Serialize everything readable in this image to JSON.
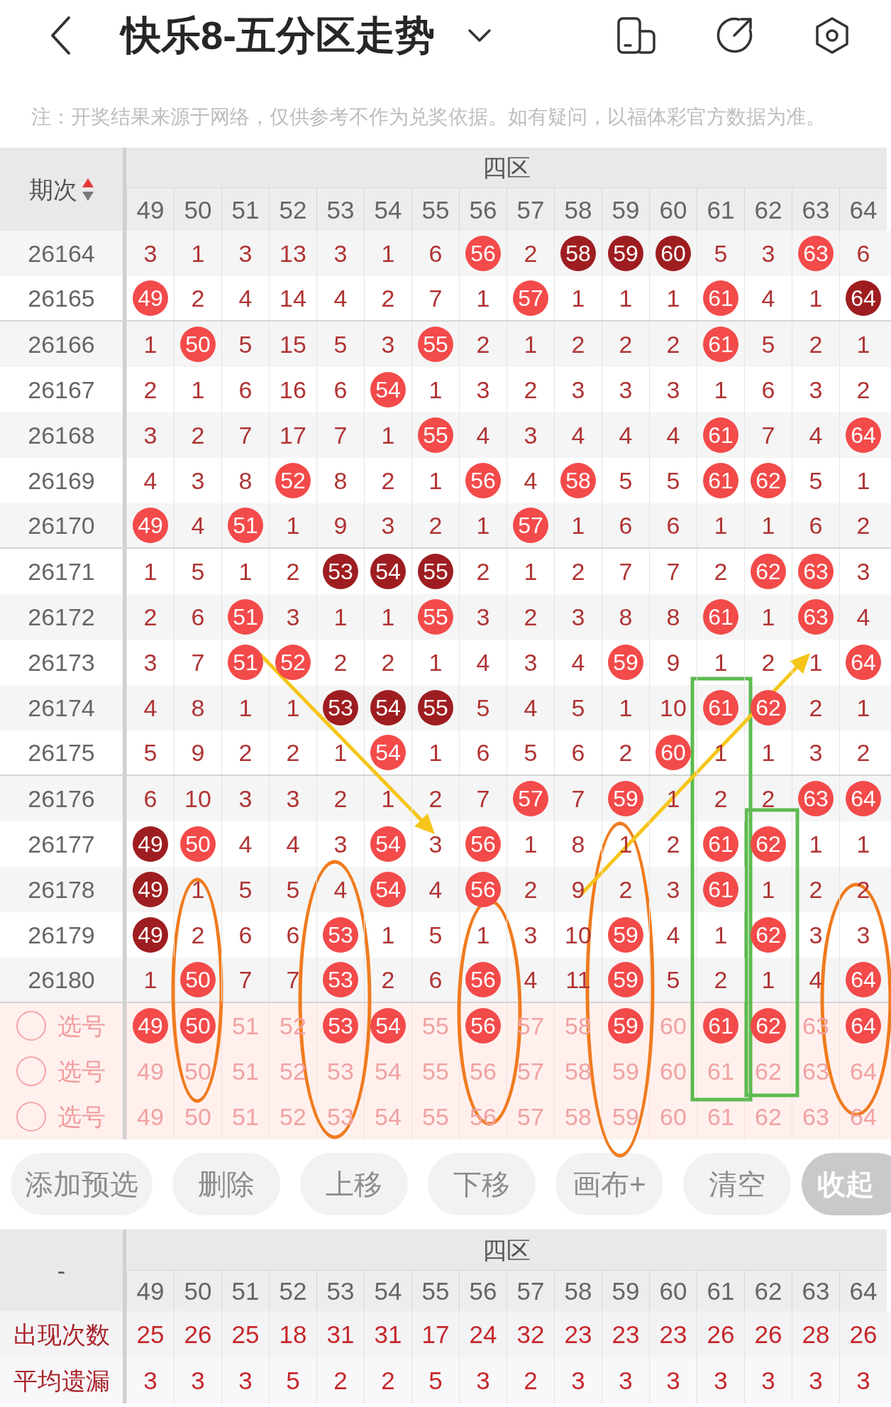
{
  "header": {
    "title": "快乐8-五分区走势"
  },
  "notice": "注：开奖结果来源于网络，仅供参考不作为兑奖依据。如有疑问，以福体彩官方数据为准。",
  "trend_table": {
    "period_header": "期次",
    "sort_ascending": true,
    "zone": "四区",
    "columns": [
      "49",
      "50",
      "51",
      "52",
      "53",
      "54",
      "55",
      "56",
      "57",
      "58",
      "59",
      "60",
      "61",
      "62",
      "63",
      "64"
    ],
    "rows": [
      {
        "period": "26164",
        "cells": [
          {
            "value": "3",
            "kind": "miss"
          },
          {
            "value": "1",
            "kind": "miss"
          },
          {
            "value": "3",
            "kind": "miss"
          },
          {
            "value": "13",
            "kind": "miss"
          },
          {
            "value": "3",
            "kind": "miss"
          },
          {
            "value": "1",
            "kind": "miss"
          },
          {
            "value": "6",
            "kind": "miss"
          },
          {
            "value": "56",
            "kind": "hit"
          },
          {
            "value": "2",
            "kind": "miss"
          },
          {
            "value": "58",
            "kind": "hit_dark"
          },
          {
            "value": "59",
            "kind": "hit_dark"
          },
          {
            "value": "60",
            "kind": "hit_dark"
          },
          {
            "value": "5",
            "kind": "miss"
          },
          {
            "value": "3",
            "kind": "miss"
          },
          {
            "value": "63",
            "kind": "hit"
          },
          {
            "value": "6",
            "kind": "miss"
          }
        ]
      },
      {
        "period": "26165",
        "cells": [
          {
            "value": "49",
            "kind": "hit"
          },
          {
            "value": "2",
            "kind": "miss"
          },
          {
            "value": "4",
            "kind": "miss"
          },
          {
            "value": "14",
            "kind": "miss"
          },
          {
            "value": "4",
            "kind": "miss"
          },
          {
            "value": "2",
            "kind": "miss"
          },
          {
            "value": "7",
            "kind": "miss"
          },
          {
            "value": "1",
            "kind": "miss"
          },
          {
            "value": "57",
            "kind": "hit"
          },
          {
            "value": "1",
            "kind": "miss"
          },
          {
            "value": "1",
            "kind": "miss"
          },
          {
            "value": "1",
            "kind": "miss"
          },
          {
            "value": "61",
            "kind": "hit"
          },
          {
            "value": "4",
            "kind": "miss"
          },
          {
            "value": "1",
            "kind": "miss"
          },
          {
            "value": "64",
            "kind": "hit_dark"
          }
        ]
      },
      {
        "period": "26166",
        "cells": [
          {
            "value": "1",
            "kind": "miss"
          },
          {
            "value": "50",
            "kind": "hit"
          },
          {
            "value": "5",
            "kind": "miss"
          },
          {
            "value": "15",
            "kind": "miss"
          },
          {
            "value": "5",
            "kind": "miss"
          },
          {
            "value": "3",
            "kind": "miss"
          },
          {
            "value": "55",
            "kind": "hit"
          },
          {
            "value": "2",
            "kind": "miss"
          },
          {
            "value": "1",
            "kind": "miss"
          },
          {
            "value": "2",
            "kind": "miss"
          },
          {
            "value": "2",
            "kind": "miss"
          },
          {
            "value": "2",
            "kind": "miss"
          },
          {
            "value": "61",
            "kind": "hit"
          },
          {
            "value": "5",
            "kind": "miss"
          },
          {
            "value": "2",
            "kind": "miss"
          },
          {
            "value": "1",
            "kind": "miss"
          }
        ]
      },
      {
        "period": "26167",
        "cells": [
          {
            "value": "2",
            "kind": "miss"
          },
          {
            "value": "1",
            "kind": "miss"
          },
          {
            "value": "6",
            "kind": "miss"
          },
          {
            "value": "16",
            "kind": "miss"
          },
          {
            "value": "6",
            "kind": "miss"
          },
          {
            "value": "54",
            "kind": "hit"
          },
          {
            "value": "1",
            "kind": "miss"
          },
          {
            "value": "3",
            "kind": "miss"
          },
          {
            "value": "2",
            "kind": "miss"
          },
          {
            "value": "3",
            "kind": "miss"
          },
          {
            "value": "3",
            "kind": "miss"
          },
          {
            "value": "3",
            "kind": "miss"
          },
          {
            "value": "1",
            "kind": "miss"
          },
          {
            "value": "6",
            "kind": "miss"
          },
          {
            "value": "3",
            "kind": "miss"
          },
          {
            "value": "2",
            "kind": "miss"
          }
        ]
      },
      {
        "period": "26168",
        "cells": [
          {
            "value": "3",
            "kind": "miss"
          },
          {
            "value": "2",
            "kind": "miss"
          },
          {
            "value": "7",
            "kind": "miss"
          },
          {
            "value": "17",
            "kind": "miss"
          },
          {
            "value": "7",
            "kind": "miss"
          },
          {
            "value": "1",
            "kind": "miss"
          },
          {
            "value": "55",
            "kind": "hit"
          },
          {
            "value": "4",
            "kind": "miss"
          },
          {
            "value": "3",
            "kind": "miss"
          },
          {
            "value": "4",
            "kind": "miss"
          },
          {
            "value": "4",
            "kind": "miss"
          },
          {
            "value": "4",
            "kind": "miss"
          },
          {
            "value": "61",
            "kind": "hit"
          },
          {
            "value": "7",
            "kind": "miss"
          },
          {
            "value": "4",
            "kind": "miss"
          },
          {
            "value": "64",
            "kind": "hit"
          }
        ]
      },
      {
        "period": "26169",
        "cells": [
          {
            "value": "4",
            "kind": "miss"
          },
          {
            "value": "3",
            "kind": "miss"
          },
          {
            "value": "8",
            "kind": "miss"
          },
          {
            "value": "52",
            "kind": "hit"
          },
          {
            "value": "8",
            "kind": "miss"
          },
          {
            "value": "2",
            "kind": "miss"
          },
          {
            "value": "1",
            "kind": "miss"
          },
          {
            "value": "56",
            "kind": "hit"
          },
          {
            "value": "4",
            "kind": "miss"
          },
          {
            "value": "58",
            "kind": "hit"
          },
          {
            "value": "5",
            "kind": "miss"
          },
          {
            "value": "5",
            "kind": "miss"
          },
          {
            "value": "61",
            "kind": "hit"
          },
          {
            "value": "62",
            "kind": "hit"
          },
          {
            "value": "5",
            "kind": "miss"
          },
          {
            "value": "1",
            "kind": "miss"
          }
        ]
      },
      {
        "period": "26170",
        "cells": [
          {
            "value": "49",
            "kind": "hit"
          },
          {
            "value": "4",
            "kind": "miss"
          },
          {
            "value": "51",
            "kind": "hit"
          },
          {
            "value": "1",
            "kind": "miss"
          },
          {
            "value": "9",
            "kind": "miss"
          },
          {
            "value": "3",
            "kind": "miss"
          },
          {
            "value": "2",
            "kind": "miss"
          },
          {
            "value": "1",
            "kind": "miss"
          },
          {
            "value": "57",
            "kind": "hit"
          },
          {
            "value": "1",
            "kind": "miss"
          },
          {
            "value": "6",
            "kind": "miss"
          },
          {
            "value": "6",
            "kind": "miss"
          },
          {
            "value": "1",
            "kind": "miss"
          },
          {
            "value": "1",
            "kind": "miss"
          },
          {
            "value": "6",
            "kind": "miss"
          },
          {
            "value": "2",
            "kind": "miss"
          }
        ]
      },
      {
        "period": "26171",
        "cells": [
          {
            "value": "1",
            "kind": "miss"
          },
          {
            "value": "5",
            "kind": "miss"
          },
          {
            "value": "1",
            "kind": "miss"
          },
          {
            "value": "2",
            "kind": "miss"
          },
          {
            "value": "53",
            "kind": "hit_dark"
          },
          {
            "value": "54",
            "kind": "hit_dark"
          },
          {
            "value": "55",
            "kind": "hit_dark"
          },
          {
            "value": "2",
            "kind": "miss"
          },
          {
            "value": "1",
            "kind": "miss"
          },
          {
            "value": "2",
            "kind": "miss"
          },
          {
            "value": "7",
            "kind": "miss"
          },
          {
            "value": "7",
            "kind": "miss"
          },
          {
            "value": "2",
            "kind": "miss"
          },
          {
            "value": "62",
            "kind": "hit"
          },
          {
            "value": "63",
            "kind": "hit"
          },
          {
            "value": "3",
            "kind": "miss"
          }
        ]
      },
      {
        "period": "26172",
        "cells": [
          {
            "value": "2",
            "kind": "miss"
          },
          {
            "value": "6",
            "kind": "miss"
          },
          {
            "value": "51",
            "kind": "hit"
          },
          {
            "value": "3",
            "kind": "miss"
          },
          {
            "value": "1",
            "kind": "miss"
          },
          {
            "value": "1",
            "kind": "miss"
          },
          {
            "value": "55",
            "kind": "hit"
          },
          {
            "value": "3",
            "kind": "miss"
          },
          {
            "value": "2",
            "kind": "miss"
          },
          {
            "value": "3",
            "kind": "miss"
          },
          {
            "value": "8",
            "kind": "miss"
          },
          {
            "value": "8",
            "kind": "miss"
          },
          {
            "value": "61",
            "kind": "hit"
          },
          {
            "value": "1",
            "kind": "miss"
          },
          {
            "value": "63",
            "kind": "hit"
          },
          {
            "value": "4",
            "kind": "miss"
          }
        ]
      },
      {
        "period": "26173",
        "cells": [
          {
            "value": "3",
            "kind": "miss"
          },
          {
            "value": "7",
            "kind": "miss"
          },
          {
            "value": "51",
            "kind": "hit"
          },
          {
            "value": "52",
            "kind": "hit"
          },
          {
            "value": "2",
            "kind": "miss"
          },
          {
            "value": "2",
            "kind": "miss"
          },
          {
            "value": "1",
            "kind": "miss"
          },
          {
            "value": "4",
            "kind": "miss"
          },
          {
            "value": "3",
            "kind": "miss"
          },
          {
            "value": "4",
            "kind": "miss"
          },
          {
            "value": "59",
            "kind": "hit"
          },
          {
            "value": "9",
            "kind": "miss"
          },
          {
            "value": "1",
            "kind": "miss"
          },
          {
            "value": "2",
            "kind": "miss"
          },
          {
            "value": "1",
            "kind": "miss"
          },
          {
            "value": "64",
            "kind": "hit"
          }
        ]
      },
      {
        "period": "26174",
        "cells": [
          {
            "value": "4",
            "kind": "miss"
          },
          {
            "value": "8",
            "kind": "miss"
          },
          {
            "value": "1",
            "kind": "miss"
          },
          {
            "value": "1",
            "kind": "miss"
          },
          {
            "value": "53",
            "kind": "hit_dark"
          },
          {
            "value": "54",
            "kind": "hit_dark"
          },
          {
            "value": "55",
            "kind": "hit_dark"
          },
          {
            "value": "5",
            "kind": "miss"
          },
          {
            "value": "4",
            "kind": "miss"
          },
          {
            "value": "5",
            "kind": "miss"
          },
          {
            "value": "1",
            "kind": "miss"
          },
          {
            "value": "10",
            "kind": "miss"
          },
          {
            "value": "61",
            "kind": "hit"
          },
          {
            "value": "62",
            "kind": "hit"
          },
          {
            "value": "2",
            "kind": "miss"
          },
          {
            "value": "1",
            "kind": "miss"
          }
        ]
      },
      {
        "period": "26175",
        "cells": [
          {
            "value": "5",
            "kind": "miss"
          },
          {
            "value": "9",
            "kind": "miss"
          },
          {
            "value": "2",
            "kind": "miss"
          },
          {
            "value": "2",
            "kind": "miss"
          },
          {
            "value": "1",
            "kind": "miss"
          },
          {
            "value": "54",
            "kind": "hit"
          },
          {
            "value": "1",
            "kind": "miss"
          },
          {
            "value": "6",
            "kind": "miss"
          },
          {
            "value": "5",
            "kind": "miss"
          },
          {
            "value": "6",
            "kind": "miss"
          },
          {
            "value": "2",
            "kind": "miss"
          },
          {
            "value": "60",
            "kind": "hit"
          },
          {
            "value": "1",
            "kind": "miss"
          },
          {
            "value": "1",
            "kind": "miss"
          },
          {
            "value": "3",
            "kind": "miss"
          },
          {
            "value": "2",
            "kind": "miss"
          }
        ]
      },
      {
        "period": "26176",
        "cells": [
          {
            "value": "6",
            "kind": "miss"
          },
          {
            "value": "10",
            "kind": "miss"
          },
          {
            "value": "3",
            "kind": "miss"
          },
          {
            "value": "3",
            "kind": "miss"
          },
          {
            "value": "2",
            "kind": "miss"
          },
          {
            "value": "1",
            "kind": "miss"
          },
          {
            "value": "2",
            "kind": "miss"
          },
          {
            "value": "7",
            "kind": "miss"
          },
          {
            "value": "57",
            "kind": "hit"
          },
          {
            "value": "7",
            "kind": "miss"
          },
          {
            "value": "59",
            "kind": "hit"
          },
          {
            "value": "1",
            "kind": "miss"
          },
          {
            "value": "2",
            "kind": "miss"
          },
          {
            "value": "2",
            "kind": "miss"
          },
          {
            "value": "63",
            "kind": "hit"
          },
          {
            "value": "64",
            "kind": "hit"
          }
        ]
      },
      {
        "period": "26177",
        "cells": [
          {
            "value": "49",
            "kind": "hit_dark"
          },
          {
            "value": "50",
            "kind": "hit"
          },
          {
            "value": "4",
            "kind": "miss"
          },
          {
            "value": "4",
            "kind": "miss"
          },
          {
            "value": "3",
            "kind": "miss"
          },
          {
            "value": "54",
            "kind": "hit"
          },
          {
            "value": "3",
            "kind": "miss"
          },
          {
            "value": "56",
            "kind": "hit"
          },
          {
            "value": "1",
            "kind": "miss"
          },
          {
            "value": "8",
            "kind": "miss"
          },
          {
            "value": "1",
            "kind": "miss"
          },
          {
            "value": "2",
            "kind": "miss"
          },
          {
            "value": "61",
            "kind": "hit"
          },
          {
            "value": "62",
            "kind": "hit"
          },
          {
            "value": "1",
            "kind": "miss"
          },
          {
            "value": "1",
            "kind": "miss"
          }
        ]
      },
      {
        "period": "26178",
        "cells": [
          {
            "value": "49",
            "kind": "hit_dark"
          },
          {
            "value": "1",
            "kind": "miss"
          },
          {
            "value": "5",
            "kind": "miss"
          },
          {
            "value": "5",
            "kind": "miss"
          },
          {
            "value": "4",
            "kind": "miss"
          },
          {
            "value": "54",
            "kind": "hit"
          },
          {
            "value": "4",
            "kind": "miss"
          },
          {
            "value": "56",
            "kind": "hit"
          },
          {
            "value": "2",
            "kind": "miss"
          },
          {
            "value": "9",
            "kind": "miss"
          },
          {
            "value": "2",
            "kind": "miss"
          },
          {
            "value": "3",
            "kind": "miss"
          },
          {
            "value": "61",
            "kind": "hit"
          },
          {
            "value": "1",
            "kind": "miss"
          },
          {
            "value": "2",
            "kind": "miss"
          },
          {
            "value": "2",
            "kind": "miss"
          }
        ]
      },
      {
        "period": "26179",
        "cells": [
          {
            "value": "49",
            "kind": "hit_dark"
          },
          {
            "value": "2",
            "kind": "miss"
          },
          {
            "value": "6",
            "kind": "miss"
          },
          {
            "value": "6",
            "kind": "miss"
          },
          {
            "value": "53",
            "kind": "hit"
          },
          {
            "value": "1",
            "kind": "miss"
          },
          {
            "value": "5",
            "kind": "miss"
          },
          {
            "value": "1",
            "kind": "miss"
          },
          {
            "value": "3",
            "kind": "miss"
          },
          {
            "value": "10",
            "kind": "miss"
          },
          {
            "value": "59",
            "kind": "hit"
          },
          {
            "value": "4",
            "kind": "miss"
          },
          {
            "value": "1",
            "kind": "miss"
          },
          {
            "value": "62",
            "kind": "hit"
          },
          {
            "value": "3",
            "kind": "miss"
          },
          {
            "value": "3",
            "kind": "miss"
          }
        ]
      },
      {
        "period": "26180",
        "cells": [
          {
            "value": "1",
            "kind": "miss"
          },
          {
            "value": "50",
            "kind": "hit"
          },
          {
            "value": "7",
            "kind": "miss"
          },
          {
            "value": "7",
            "kind": "miss"
          },
          {
            "value": "53",
            "kind": "hit"
          },
          {
            "value": "2",
            "kind": "miss"
          },
          {
            "value": "6",
            "kind": "miss"
          },
          {
            "value": "56",
            "kind": "hit"
          },
          {
            "value": "4",
            "kind": "miss"
          },
          {
            "value": "11",
            "kind": "miss"
          },
          {
            "value": "59",
            "kind": "hit"
          },
          {
            "value": "5",
            "kind": "miss"
          },
          {
            "value": "2",
            "kind": "miss"
          },
          {
            "value": "1",
            "kind": "miss"
          },
          {
            "value": "4",
            "kind": "miss"
          },
          {
            "value": "64",
            "kind": "hit"
          }
        ]
      }
    ],
    "pick_rows": [
      {
        "label": "选号",
        "checked": false,
        "cells": [
          {
            "value": "49",
            "selected": true
          },
          {
            "value": "50",
            "selected": true
          },
          {
            "value": "51",
            "selected": false
          },
          {
            "value": "52",
            "selected": false
          },
          {
            "value": "53",
            "selected": true
          },
          {
            "value": "54",
            "selected": true
          },
          {
            "value": "55",
            "selected": false
          },
          {
            "value": "56",
            "selected": true
          },
          {
            "value": "57",
            "selected": false
          },
          {
            "value": "58",
            "selected": false
          },
          {
            "value": "59",
            "selected": true
          },
          {
            "value": "60",
            "selected": false
          },
          {
            "value": "61",
            "selected": true
          },
          {
            "value": "62",
            "selected": true
          },
          {
            "value": "63",
            "selected": false
          },
          {
            "value": "64",
            "selected": true
          }
        ]
      },
      {
        "label": "选号",
        "checked": false,
        "cells": [
          {
            "value": "49",
            "selected": false
          },
          {
            "value": "50",
            "selected": false
          },
          {
            "value": "51",
            "selected": false
          },
          {
            "value": "52",
            "selected": false
          },
          {
            "value": "53",
            "selected": false
          },
          {
            "value": "54",
            "selected": false
          },
          {
            "value": "55",
            "selected": false
          },
          {
            "value": "56",
            "selected": false
          },
          {
            "value": "57",
            "selected": false
          },
          {
            "value": "58",
            "selected": false
          },
          {
            "value": "59",
            "selected": false
          },
          {
            "value": "60",
            "selected": false
          },
          {
            "value": "61",
            "selected": false
          },
          {
            "value": "62",
            "selected": false
          },
          {
            "value": "63",
            "selected": false
          },
          {
            "value": "64",
            "selected": false
          }
        ]
      },
      {
        "label": "选号",
        "checked": false,
        "cells": [
          {
            "value": "49",
            "selected": false
          },
          {
            "value": "50",
            "selected": false
          },
          {
            "value": "51",
            "selected": false
          },
          {
            "value": "52",
            "selected": false
          },
          {
            "value": "53",
            "selected": false
          },
          {
            "value": "54",
            "selected": false
          },
          {
            "value": "55",
            "selected": false
          },
          {
            "value": "56",
            "selected": false
          },
          {
            "value": "57",
            "selected": false
          },
          {
            "value": "58",
            "selected": false
          },
          {
            "value": "59",
            "selected": false
          },
          {
            "value": "60",
            "selected": false
          },
          {
            "value": "61",
            "selected": false
          },
          {
            "value": "62",
            "selected": false
          },
          {
            "value": "63",
            "selected": false
          },
          {
            "value": "64",
            "selected": false
          }
        ]
      }
    ]
  },
  "buttons": [
    {
      "label": "添加预选",
      "kind": "action"
    },
    {
      "label": "删除",
      "kind": "action"
    },
    {
      "label": "上移",
      "kind": "action"
    },
    {
      "label": "下移",
      "kind": "action"
    },
    {
      "label": "画布+",
      "kind": "action"
    },
    {
      "label": "清空",
      "kind": "action"
    },
    {
      "label": "收起",
      "kind": "collapse"
    }
  ],
  "stats_table": {
    "corner": "-",
    "zone": "四区",
    "columns": [
      "49",
      "50",
      "51",
      "52",
      "53",
      "54",
      "55",
      "56",
      "57",
      "58",
      "59",
      "60",
      "61",
      "62",
      "63",
      "64"
    ],
    "rows": [
      {
        "label": "出现次数",
        "values": [
          "25",
          "26",
          "25",
          "18",
          "31",
          "31",
          "17",
          "24",
          "32",
          "23",
          "23",
          "23",
          "26",
          "26",
          "28",
          "26"
        ]
      },
      {
        "label": "平均遗漏",
        "values": [
          "3",
          "3",
          "3",
          "5",
          "2",
          "2",
          "5",
          "3",
          "2",
          "3",
          "3",
          "3",
          "3",
          "3",
          "3",
          "3"
        ]
      }
    ]
  }
}
